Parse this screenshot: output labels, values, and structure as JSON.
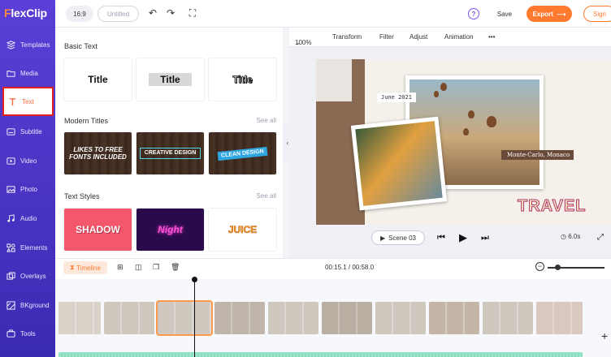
{
  "app": {
    "logo_f": "F",
    "logo_rest": "lexClip"
  },
  "topbar": {
    "ratio": "16:9",
    "title_placeholder": "Untitled",
    "help": "?",
    "save": "Save",
    "export": "Export",
    "signup": "Sign"
  },
  "sidebar": {
    "items": [
      {
        "label": "Templates",
        "icon": "templates-icon"
      },
      {
        "label": "Media",
        "icon": "folder-icon"
      },
      {
        "label": "Text",
        "icon": "text-icon"
      },
      {
        "label": "Subtitle",
        "icon": "subtitle-icon"
      },
      {
        "label": "Video",
        "icon": "video-icon"
      },
      {
        "label": "Photo",
        "icon": "photo-icon"
      },
      {
        "label": "Audio",
        "icon": "music-icon"
      },
      {
        "label": "Elements",
        "icon": "elements-icon"
      },
      {
        "label": "Overlays",
        "icon": "overlays-icon"
      },
      {
        "label": "BKground",
        "icon": "background-icon"
      },
      {
        "label": "Tools",
        "icon": "tools-icon"
      }
    ],
    "active_index": 2
  },
  "panel": {
    "basic": {
      "title": "Basic Text",
      "cards": [
        "Title",
        "Title",
        "Title"
      ]
    },
    "modern": {
      "title": "Modern Titles",
      "see_all": "See all",
      "cards": [
        "LIKES TO FREE FONTS INCLUDED",
        "CREATIVE DESIGN",
        "CLEAN DESIGN"
      ]
    },
    "styles": {
      "title": "Text Styles",
      "see_all": "See all",
      "cards": [
        "SHADOW",
        "Night",
        "JUICE"
      ]
    }
  },
  "preview_toolbar": {
    "zoom": "100%",
    "items": [
      "Transform",
      "Filter",
      "Adjust",
      "Animation"
    ],
    "more": "•••"
  },
  "canvas": {
    "date": "June 2021",
    "place": "Monte-Carlo, Monaco",
    "travel": "TRAVEL"
  },
  "player": {
    "scene": "Scene 03",
    "duration": "6.0s"
  },
  "timeline": {
    "label": "Timeline",
    "current_time": "00:15.1 / 00:58.0",
    "zoom_level": 0.15
  },
  "colors": {
    "brand_purple": "#5b3fd6",
    "accent_orange": "#ff7a2f",
    "audio_green": "#7fd9b7"
  }
}
